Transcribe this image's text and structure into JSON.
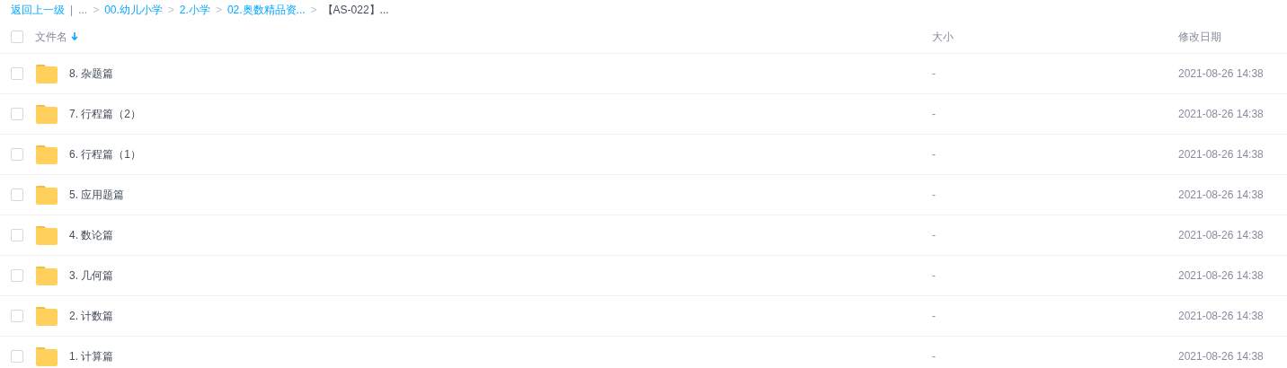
{
  "breadcrumb": [
    {
      "text": "返回上一级",
      "kind": "link"
    },
    {
      "text": "|",
      "kind": "plain"
    },
    {
      "text": "...",
      "kind": "plain"
    },
    {
      "text": ">",
      "kind": "separator"
    },
    {
      "text": "00.幼儿小学",
      "kind": "link"
    },
    {
      "text": ">",
      "kind": "separator"
    },
    {
      "text": "2.小学",
      "kind": "link"
    },
    {
      "text": ">",
      "kind": "separator"
    },
    {
      "text": "02.奥数精品资...",
      "kind": "link"
    },
    {
      "text": ">",
      "kind": "separator"
    },
    {
      "text": "【AS-022】...",
      "kind": "current"
    }
  ],
  "header": {
    "checked": false,
    "columns": [
      "文件名",
      "大小",
      "修改日期"
    ],
    "sort_desc": true
  },
  "rows": [
    {
      "name": "8. 杂题篇",
      "size": "-",
      "modified": "2021-08-26 14:38",
      "checked": false
    },
    {
      "name": "7. 行程篇（2）",
      "size": "-",
      "modified": "2021-08-26 14:38",
      "checked": false
    },
    {
      "name": "6. 行程篇（1）",
      "size": "-",
      "modified": "2021-08-26 14:38",
      "checked": false
    },
    {
      "name": "5. 应用题篇",
      "size": "-",
      "modified": "2021-08-26 14:38",
      "checked": false
    },
    {
      "name": "4. 数论篇",
      "size": "-",
      "modified": "2021-08-26 14:38",
      "checked": false
    },
    {
      "name": "3. 几何篇",
      "size": "-",
      "modified": "2021-08-26 14:38",
      "checked": false
    },
    {
      "name": "2. 计数篇",
      "size": "-",
      "modified": "2021-08-26 14:38",
      "checked": false
    },
    {
      "name": "1. 计算篇",
      "size": "-",
      "modified": "2021-08-26 14:38",
      "checked": false
    }
  ]
}
